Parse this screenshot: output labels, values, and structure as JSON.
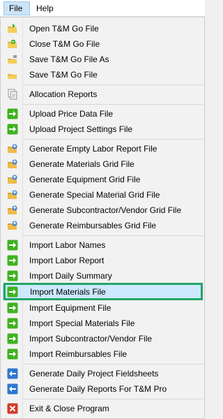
{
  "menubar": {
    "file": "File",
    "help": "Help"
  },
  "menu": {
    "items": [
      {
        "label": "Open T&M Go File",
        "icon": "open-folder-icon"
      },
      {
        "label": "Close T&M Go File",
        "icon": "close-file-icon"
      },
      {
        "label": "Save T&M Go File As",
        "icon": "save-as-icon"
      },
      {
        "label": "Save T&M Go File",
        "icon": "save-icon"
      },
      {
        "label": "Allocation Reports",
        "icon": "reports-icon"
      },
      {
        "label": "Upload Price Data File",
        "icon": "upload-arrow-icon"
      },
      {
        "label": "Upload Project Settings File",
        "icon": "upload-arrow-icon"
      },
      {
        "label": "Generate Empty Labor Report File",
        "icon": "generate-folder-icon"
      },
      {
        "label": "Generate Materials Grid File",
        "icon": "generate-folder-icon"
      },
      {
        "label": "Generate Equipment Grid File",
        "icon": "generate-folder-icon"
      },
      {
        "label": "Generate Special Material Grid File",
        "icon": "generate-folder-icon"
      },
      {
        "label": "Generate Subcontractor/Vendor Grid File",
        "icon": "generate-folder-icon"
      },
      {
        "label": "Generate Reimbursables Grid File",
        "icon": "generate-folder-icon"
      },
      {
        "label": "Import Labor Names",
        "icon": "import-arrow-icon"
      },
      {
        "label": "Import Labor Report",
        "icon": "import-arrow-icon"
      },
      {
        "label": "Import Daily Summary",
        "icon": "import-arrow-icon"
      },
      {
        "label": "Import Materials File",
        "icon": "import-arrow-icon"
      },
      {
        "label": "Import Equipment File",
        "icon": "import-arrow-icon"
      },
      {
        "label": "Import Special Materials File",
        "icon": "import-arrow-icon"
      },
      {
        "label": "Import Subcontractor/Vendor File",
        "icon": "import-arrow-icon"
      },
      {
        "label": "Import Reimbursables File",
        "icon": "import-arrow-icon"
      },
      {
        "label": "Generate Daily Project Fieldsheets",
        "icon": "back-arrow-icon"
      },
      {
        "label": "Generate Daily Reports For T&M Pro",
        "icon": "back-arrow-icon"
      },
      {
        "label": "Exit & Close Program",
        "icon": "exit-icon"
      }
    ]
  },
  "colors": {
    "highlight": "#cde8ff",
    "focus_outline": "#22a564",
    "green_arrow": "#3fb21f",
    "blue_arrow": "#2f78d0",
    "exit_red": "#d33b2a"
  }
}
